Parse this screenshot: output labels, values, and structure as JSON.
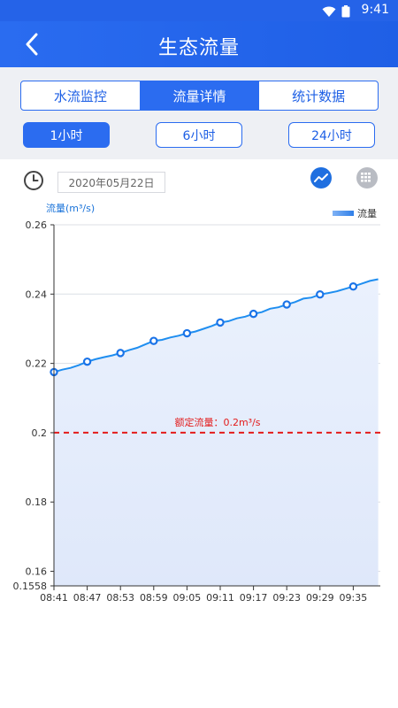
{
  "status_bar": {
    "time": "9:41",
    "wifi_icon": "wifi-icon",
    "battery_icon": "battery-icon"
  },
  "header": {
    "title": "生态流量",
    "back_icon": "chevron-left-icon"
  },
  "tabs": [
    {
      "label": "水流监控",
      "active": false
    },
    {
      "label": "流量详情",
      "active": true
    },
    {
      "label": "统计数据",
      "active": false
    }
  ],
  "ranges": [
    {
      "label": "1小时",
      "active": true
    },
    {
      "label": "6小时",
      "active": false
    },
    {
      "label": "24小时",
      "active": false
    }
  ],
  "toolbar": {
    "clock_icon": "clock-icon",
    "date": "2020年05月22日",
    "line_chart_icon": "line-chart-icon",
    "grid_icon": "grid-table-icon"
  },
  "colors": {
    "primary": "#2b6cf0",
    "line": "#1f8ef0",
    "fill": "#e4ecfb",
    "threshold": "#e31b1b"
  },
  "chart_data": {
    "type": "line",
    "ylabel": "流量(m³/s)",
    "legend": "流量",
    "legend_position": "top-right",
    "ylim": [
      0.1558,
      0.26
    ],
    "yticks": [
      0.1558,
      0.16,
      0.18,
      0.2,
      0.22,
      0.24,
      0.26
    ],
    "xticks": [
      "08:41",
      "08:47",
      "08:53",
      "08:59",
      "09:05",
      "09:11",
      "09:17",
      "09:23",
      "09:29",
      "09:35"
    ],
    "grid": "horizontal",
    "threshold": {
      "value": 0.2,
      "label": "额定流量：0.2m³/s"
    },
    "series": [
      {
        "name": "流量",
        "markers": [
          {
            "x": 0,
            "y": 0.2175
          },
          {
            "x": 1,
            "y": 0.2205
          },
          {
            "x": 2,
            "y": 0.223
          },
          {
            "x": 3,
            "y": 0.2265
          },
          {
            "x": 4,
            "y": 0.2287
          },
          {
            "x": 5,
            "y": 0.2318
          },
          {
            "x": 6,
            "y": 0.2343
          },
          {
            "x": 7,
            "y": 0.237
          },
          {
            "x": 8,
            "y": 0.2399
          },
          {
            "x": 9,
            "y": 0.2422
          }
        ],
        "line": [
          [
            0,
            0.2175
          ],
          [
            0.25,
            0.2182
          ],
          [
            0.5,
            0.2187
          ],
          [
            0.75,
            0.2195
          ],
          [
            1,
            0.2205
          ],
          [
            1.25,
            0.2212
          ],
          [
            1.5,
            0.2218
          ],
          [
            1.75,
            0.2223
          ],
          [
            2,
            0.223
          ],
          [
            2.25,
            0.2238
          ],
          [
            2.5,
            0.2245
          ],
          [
            2.75,
            0.2255
          ],
          [
            3,
            0.2265
          ],
          [
            3.25,
            0.2268
          ],
          [
            3.5,
            0.2275
          ],
          [
            3.75,
            0.228
          ],
          [
            4,
            0.2287
          ],
          [
            4.25,
            0.2292
          ],
          [
            4.5,
            0.23
          ],
          [
            4.75,
            0.2308
          ],
          [
            5,
            0.2318
          ],
          [
            5.25,
            0.2322
          ],
          [
            5.5,
            0.233
          ],
          [
            5.75,
            0.2335
          ],
          [
            6,
            0.2343
          ],
          [
            6.25,
            0.2348
          ],
          [
            6.5,
            0.2358
          ],
          [
            6.75,
            0.2362
          ],
          [
            7,
            0.237
          ],
          [
            7.25,
            0.2377
          ],
          [
            7.5,
            0.2387
          ],
          [
            7.75,
            0.239
          ],
          [
            8,
            0.2399
          ],
          [
            8.25,
            0.2403
          ],
          [
            8.5,
            0.2408
          ],
          [
            8.75,
            0.2415
          ],
          [
            9,
            0.2422
          ],
          [
            9.25,
            0.243
          ],
          [
            9.5,
            0.2438
          ],
          [
            9.75,
            0.2443
          ]
        ]
      }
    ]
  }
}
